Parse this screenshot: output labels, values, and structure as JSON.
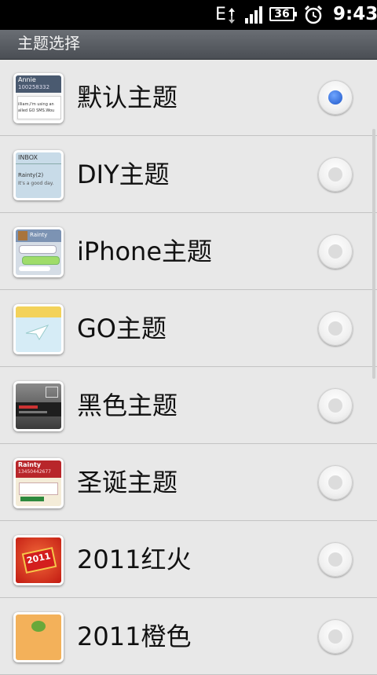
{
  "status_bar": {
    "network": "E",
    "battery": "36",
    "time": "9:43",
    "icons": [
      "network-type-icon",
      "signal-icon",
      "battery-icon",
      "alarm-icon"
    ]
  },
  "title": "主题选择",
  "themes": [
    {
      "label": "默认主题",
      "selected": true,
      "thumb": {
        "line1": "Annie",
        "line2": "100258332",
        "line3": "illiam,I'm using an",
        "line4": "alled GO SMS.Wou"
      }
    },
    {
      "label": "DIY主题",
      "selected": false,
      "thumb": {
        "line1": "INBOX",
        "line2": "Rainty(2)",
        "line3": "It's a good day."
      }
    },
    {
      "label": "iPhone主题",
      "selected": false,
      "thumb": {
        "line1": "Rainty"
      }
    },
    {
      "label": "GO主题",
      "selected": false
    },
    {
      "label": "黑色主题",
      "selected": false
    },
    {
      "label": "圣诞主题",
      "selected": false,
      "thumb": {
        "line1": "Rainty",
        "line2": "13450442677"
      }
    },
    {
      "label": "2011红火",
      "selected": false,
      "thumb": {
        "line1": "2011"
      }
    },
    {
      "label": "2011橙色",
      "selected": false
    }
  ],
  "colors": {
    "accent": "#2f6fe0",
    "title_bar": "#55595f",
    "list_bg": "#e8e8e8"
  }
}
